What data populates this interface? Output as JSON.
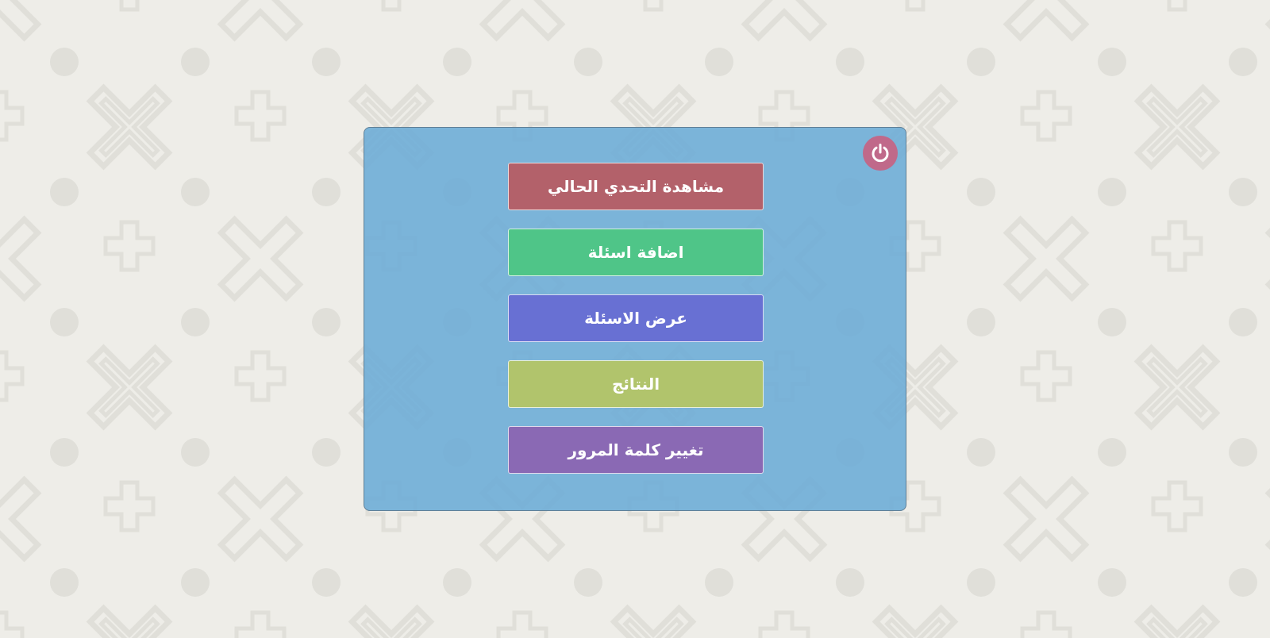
{
  "colors": {
    "page_background": "#eeede8",
    "pattern": "#e0dfd9",
    "panel_background": "#6bacd6",
    "power_button": "#c0698a"
  },
  "panel": {
    "power_button": {
      "icon": "power-icon",
      "color": "#c0698a"
    },
    "menu": [
      {
        "id": "view-current-challenge",
        "label": "مشاهدة التحدي الحالي",
        "color": "#b3616a"
      },
      {
        "id": "add-questions",
        "label": "اضافة اسئلة",
        "color": "#4fc588"
      },
      {
        "id": "view-questions",
        "label": "عرض الاسئلة",
        "color": "#6870d3"
      },
      {
        "id": "results",
        "label": "النتائج",
        "color": "#b1c46c"
      },
      {
        "id": "change-password",
        "label": "تغيير كلمة المرور",
        "color": "#8a69b4"
      }
    ]
  }
}
